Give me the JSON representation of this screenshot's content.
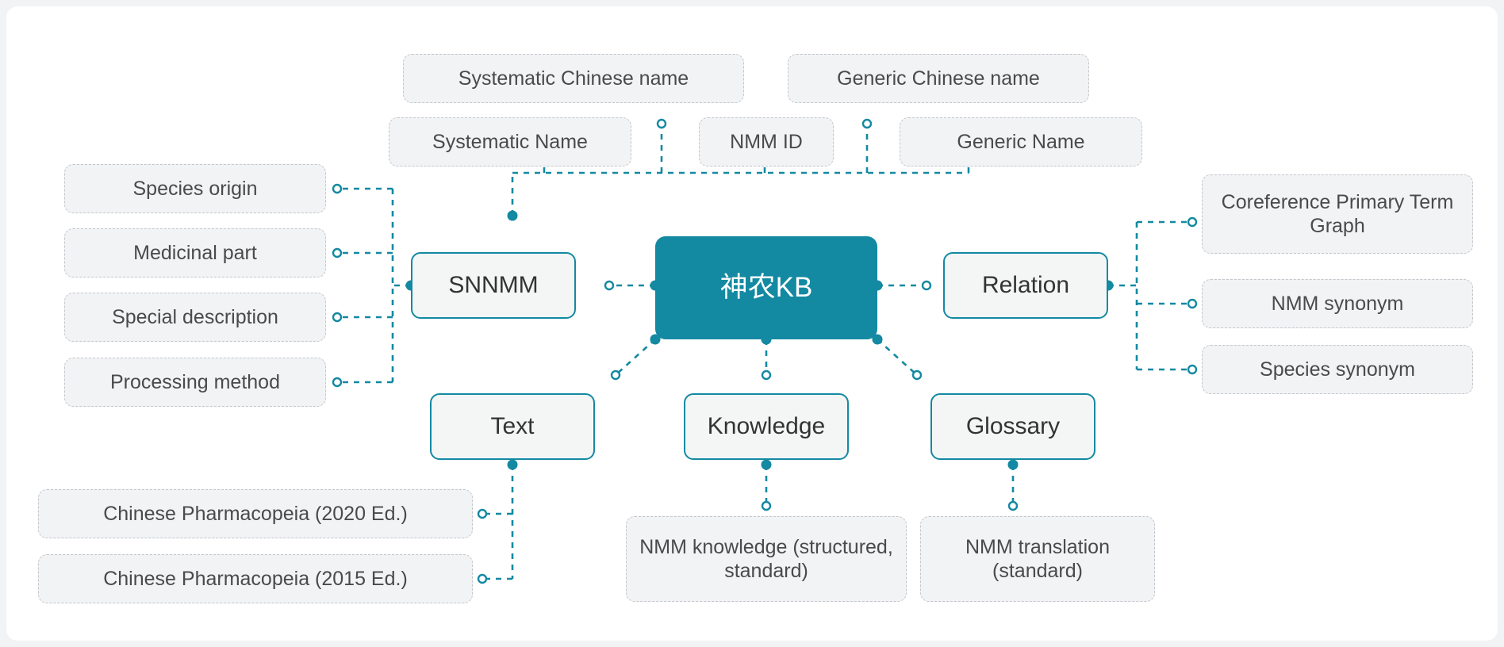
{
  "diagram": {
    "title": "神农KB knowledge base structure",
    "accent_color": "#1389a2",
    "leaf_fill": "#f2f3f5",
    "leaf_border": "#c3c6ca",
    "canvas_background": "#ffffff",
    "page_background": "#f2f3f5"
  },
  "root": {
    "label": "神农KB"
  },
  "branches": {
    "snnmm": {
      "label": "SNNMM"
    },
    "relation": {
      "label": "Relation"
    },
    "text": {
      "label": "Text"
    },
    "knowledge": {
      "label": "Knowledge"
    },
    "glossary": {
      "label": "Glossary"
    }
  },
  "leaves": {
    "top": [
      {
        "label": "Systematic Chinese name"
      },
      {
        "label": "Generic Chinese name"
      },
      {
        "label": "Systematic Name"
      },
      {
        "label": "NMM ID"
      },
      {
        "label": "Generic Name"
      }
    ],
    "left": [
      {
        "label": "Species origin"
      },
      {
        "label": "Medicinal part"
      },
      {
        "label": "Special description"
      },
      {
        "label": "Processing method"
      }
    ],
    "right": [
      {
        "label": "Coreference Primary Term Graph"
      },
      {
        "label": "NMM synonym"
      },
      {
        "label": "Species synonym"
      }
    ],
    "text_children": [
      {
        "label": "Chinese Pharmacopeia (2020 Ed.)"
      },
      {
        "label": "Chinese Pharmacopeia (2015 Ed.)"
      }
    ],
    "knowledge_children": [
      {
        "label": "NMM knowledge (structured, standard)"
      }
    ],
    "glossary_children": [
      {
        "label": "NMM translation (standard)"
      }
    ]
  }
}
